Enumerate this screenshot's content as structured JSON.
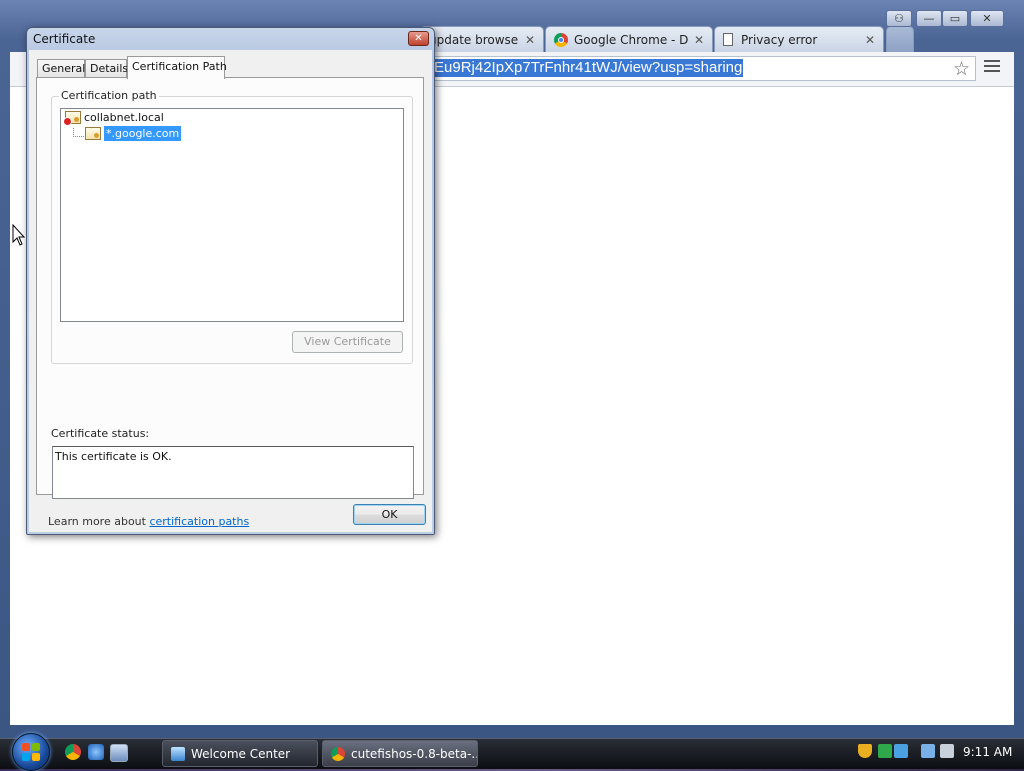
{
  "browser": {
    "tabs": [
      {
        "title": "update browse",
        "close": "✕"
      },
      {
        "title": "Google Chrome - Do",
        "close": "✕"
      },
      {
        "title": "Privacy error",
        "close": "✕"
      }
    ],
    "url": "Eu9Rj42IpXp7TrFnhr41tWJ/view?usp=sharing",
    "window_controls": {
      "user": "⚇",
      "minimize": "—",
      "maximize": "▭",
      "close": "✕"
    }
  },
  "dialog": {
    "title": "Certificate",
    "close": "✕",
    "tabs": [
      "General",
      "Details",
      "Certification Path"
    ],
    "path_group_label": "Certification path",
    "path_items": [
      "collabnet.local",
      "*.google.com"
    ],
    "view_button": "View Certificate",
    "status_label": "Certificate status:",
    "status_text": "This certificate is OK.",
    "learn_prefix": "Learn more about ",
    "learn_link": "certification paths",
    "ok_button": "OK"
  },
  "taskbar": {
    "tasks": [
      {
        "label": "Welcome Center"
      },
      {
        "label": "cutefishos-0.8-beta-..."
      }
    ],
    "clock": "9:11 AM"
  },
  "colors": {
    "selection": "#3399ff",
    "link": "#0066cc",
    "url_highlight": "#3a78d6"
  }
}
